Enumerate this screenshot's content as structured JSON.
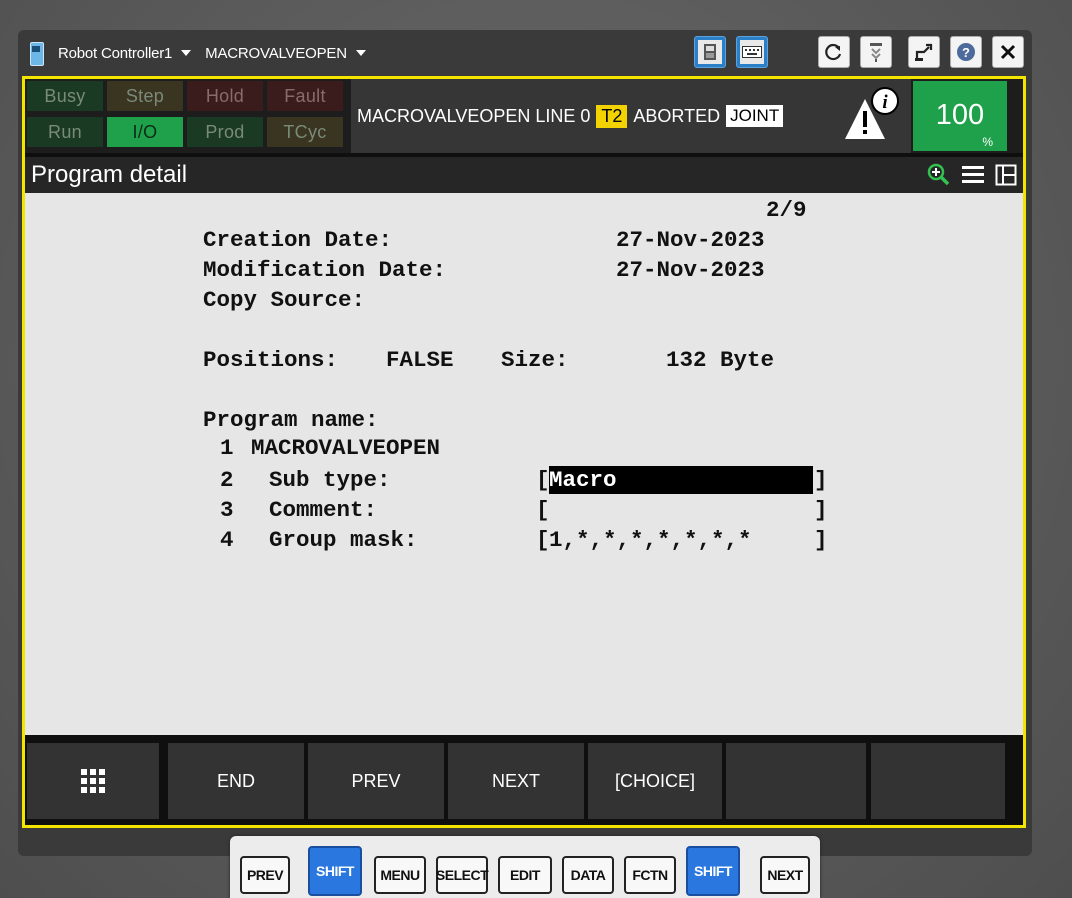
{
  "window": {
    "controller": "Robot Controller1",
    "program": "MACROVALVEOPEN"
  },
  "status": {
    "indicators": [
      {
        "label": "Busy",
        "on": false
      },
      {
        "label": "Step",
        "on": false
      },
      {
        "label": "Hold",
        "on": false
      },
      {
        "label": "Fault",
        "on": false
      },
      {
        "label": "Run",
        "on": false
      },
      {
        "label": "I/O",
        "on": true
      },
      {
        "label": "Prod",
        "on": false
      },
      {
        "label": "TCyc",
        "on": false
      }
    ],
    "message": {
      "program_line": "MACROVALVEOPEN LINE 0",
      "mode": "T2",
      "state": "ABORTED",
      "coord": "JOINT"
    },
    "override": {
      "value": "100",
      "unit": "%"
    }
  },
  "header": {
    "title": "Program detail"
  },
  "detail": {
    "page": "2/9",
    "creation_label": "Creation Date:",
    "creation_value": "27-Nov-2023",
    "modification_label": "Modification Date:",
    "modification_value": "27-Nov-2023",
    "copy_source_label": "Copy Source:",
    "positions_label": "Positions:",
    "positions_value": "FALSE",
    "size_label": "Size:",
    "size_value": "132 Byte",
    "program_name_label": "Program name:",
    "items": [
      {
        "num": "1",
        "text": "MACROVALVEOPEN"
      },
      {
        "num": "2",
        "label": "Sub type:",
        "value": "Macro"
      },
      {
        "num": "3",
        "label": "Comment:",
        "value": ""
      },
      {
        "num": "4",
        "label": "Group mask:",
        "value": "1,*,*,*,*,*,*,*"
      }
    ]
  },
  "function_keys": [
    "END",
    "PREV",
    "NEXT",
    "[CHOICE]",
    "",
    ""
  ],
  "hard_keys": [
    "PREV",
    "SHIFT",
    "MENU",
    "SELECT",
    "EDIT",
    "DATA",
    "FCTN",
    "SHIFT",
    "NEXT"
  ],
  "colors": {
    "screen_border": "#f2e600",
    "override_green": "#1ea14a",
    "io_green": "#1ea14a",
    "shift_blue": "#2a77e0"
  }
}
